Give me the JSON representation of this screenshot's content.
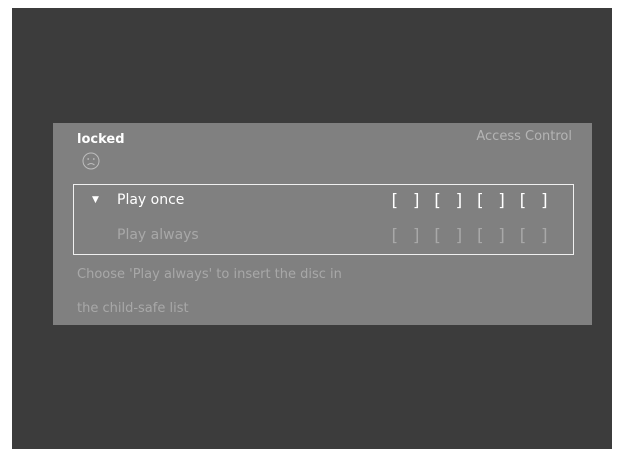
{
  "panel": {
    "status_label": "locked",
    "title": "Access Control",
    "options": [
      {
        "label": "Play once",
        "selected": true,
        "pin_slots": [
          "[ ]",
          "[ ]",
          "[ ]",
          "[ ]"
        ]
      },
      {
        "label": "Play always",
        "selected": false,
        "pin_slots": [
          "[ ]",
          "[ ]",
          "[ ]",
          "[ ]"
        ]
      }
    ],
    "selection_marker": "▼",
    "help_lines": [
      "Choose 'Play always' to insert the disc in",
      "the child-safe list"
    ],
    "icons": {
      "status": "sad-face-icon",
      "selection": "triangle-down-icon"
    }
  },
  "colors": {
    "screen_background": "#3c3c3c",
    "panel_background": "#808080",
    "active_text": "#ffffff",
    "inactive_text": "#a8a8a8"
  }
}
